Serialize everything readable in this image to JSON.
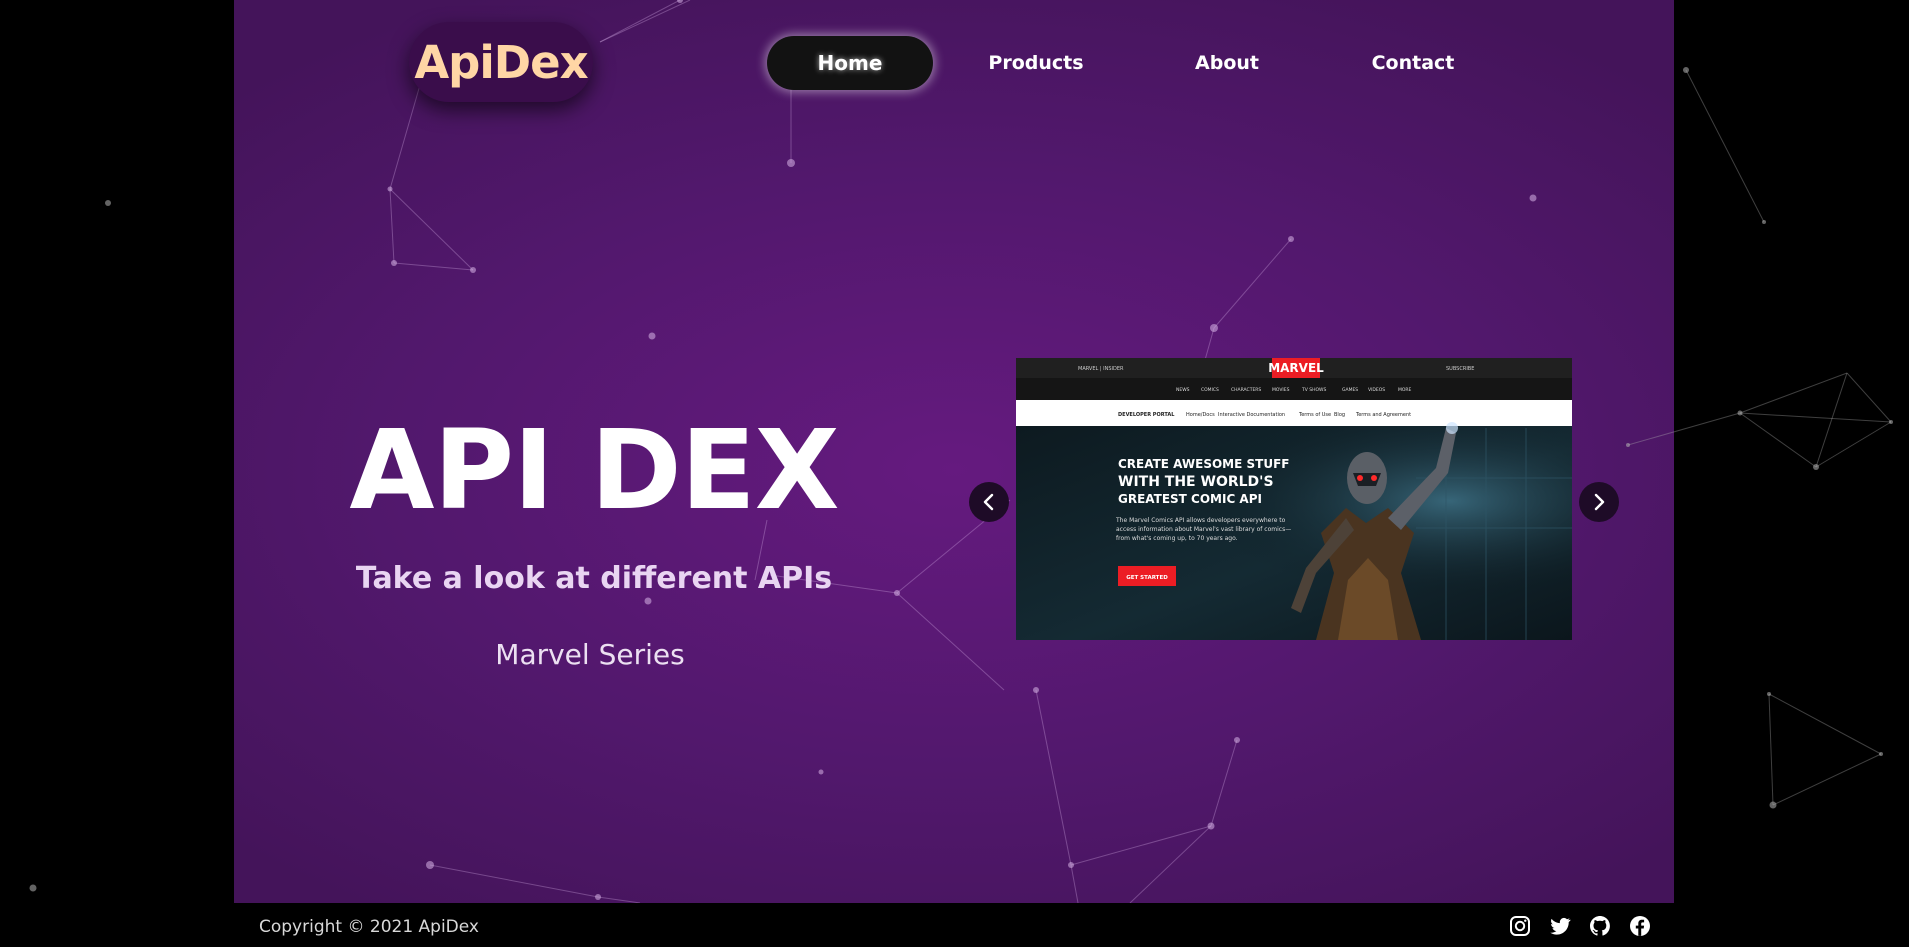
{
  "brand": {
    "logo_text": "ApiDex"
  },
  "nav": {
    "items": [
      {
        "label": "Home",
        "active": true
      },
      {
        "label": "Products",
        "active": false
      },
      {
        "label": "About",
        "active": false
      },
      {
        "label": "Contact",
        "active": false
      }
    ]
  },
  "hero": {
    "title": "API DEX",
    "subtitle": "Take a look at different APIs",
    "series_name": "Marvel Series"
  },
  "carousel": {
    "slide": {
      "site_logo": "MARVEL",
      "top_left": "MARVEL | INSIDER",
      "top_right": "SUBSCRIBE",
      "nav_links": [
        "NEWS",
        "COMICS",
        "CHARACTERS",
        "MOVIES",
        "TV SHOWS",
        "GAMES",
        "VIDEOS",
        "MORE"
      ],
      "subnav_brand": "DEVELOPER PORTAL",
      "subnav_links": [
        "Home/Docs",
        "Interactive Documentation",
        "Terms of Use",
        "Blog",
        "Terms and Agreement"
      ],
      "headline_lines": [
        "CREATE AWESOME STUFF",
        "WITH THE WORLD'S",
        "GREATEST COMIC API"
      ],
      "body_text": "The Marvel Comics API allows developers everywhere to access information about Marvel's vast library of comics—from what's coming up, to 70 years ago.",
      "cta_label": "GET STARTED"
    }
  },
  "footer": {
    "copyright": "Copyright © 2021 ApiDex",
    "social_icons": [
      "instagram-icon",
      "twitter-icon",
      "github-icon",
      "facebook-icon"
    ]
  },
  "colors": {
    "panel_purple": "#5a1a73",
    "logo_text": "#ffd6a5",
    "logo_bg": "#3a0d4b",
    "nav_active_bg": "#121212",
    "page_bg": "#000000",
    "marvel_red": "#ec1d24"
  }
}
